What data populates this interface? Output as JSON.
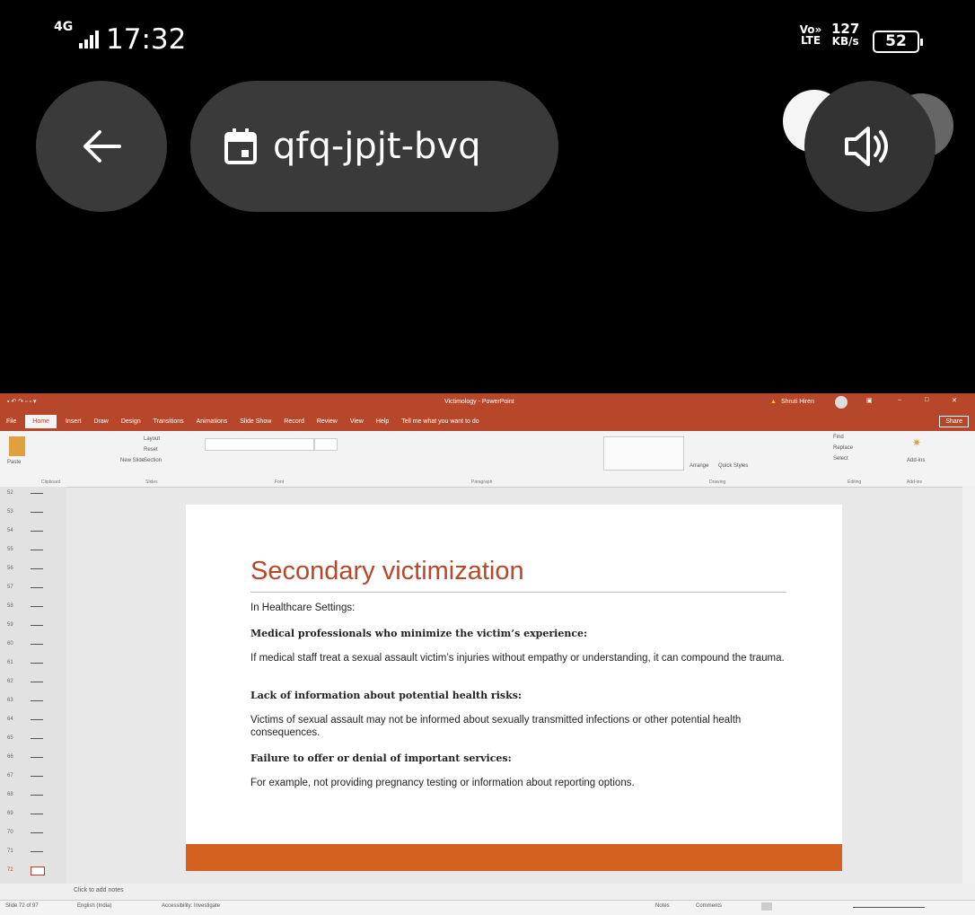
{
  "status_bar": {
    "network": "4G",
    "time": "17:32",
    "volte": "Vo» LTE",
    "speed_value": "127",
    "speed_unit": "KB/s",
    "battery": "52"
  },
  "meeting": {
    "code": "qfq-jpjt-bvq"
  },
  "powerpoint": {
    "window_title": "Victimology - PowerPoint",
    "user": "Shruti Hiren",
    "tabs": [
      "File",
      "Home",
      "Insert",
      "Draw",
      "Design",
      "Transitions",
      "Animations",
      "Slide Show",
      "Record",
      "Review",
      "View",
      "Help",
      "Tell me what you want to do"
    ],
    "share_label": "Share",
    "ribbon_groups": [
      "Clipboard",
      "Slides",
      "Font",
      "Paragraph",
      "Drawing",
      "Editing",
      "Add-ins"
    ],
    "ribbon_labels": {
      "paste": "Paste",
      "new_slide": "New Slide",
      "layout": "Layout",
      "reset": "Reset",
      "section": "Section",
      "arrange": "Arrange",
      "quick_styles": "Quick Styles",
      "find": "Find",
      "replace": "Replace",
      "select": "Select",
      "addins": "Add-ins"
    },
    "thumbnail_numbers": [
      "52",
      "53",
      "54",
      "55",
      "56",
      "57",
      "58",
      "59",
      "60",
      "61",
      "62",
      "63",
      "64",
      "65",
      "66",
      "67",
      "68",
      "69",
      "70",
      "71",
      "72"
    ],
    "slide": {
      "title": "Secondary victimization",
      "lines": [
        {
          "text": "In Healthcare Settings:",
          "bold": false
        },
        {
          "text": "Medical professionals who minimize the victim’s experience:",
          "bold": true
        },
        {
          "text": "If medical staff treat a sexual assault victim’s injuries without empathy or understanding, it can compound the trauma.",
          "bold": false
        },
        {
          "text": "Lack of information about potential health risks:",
          "bold": true
        },
        {
          "text": "Victims of sexual assault may not be informed about sexually transmitted infections or other potential health consequences.",
          "bold": false
        },
        {
          "text": "Failure to offer or denial of important services:",
          "bold": true
        },
        {
          "text": "For example, not providing pregnancy testing or information about reporting options.",
          "bold": false
        }
      ]
    },
    "notes_placeholder": "Click to add notes",
    "statusbar": {
      "slide_info": "Slide 72 of 97",
      "language": "English (India)",
      "accessibility": "Accessibility: Investigate",
      "notes": "Notes",
      "comments": "Comments"
    }
  }
}
